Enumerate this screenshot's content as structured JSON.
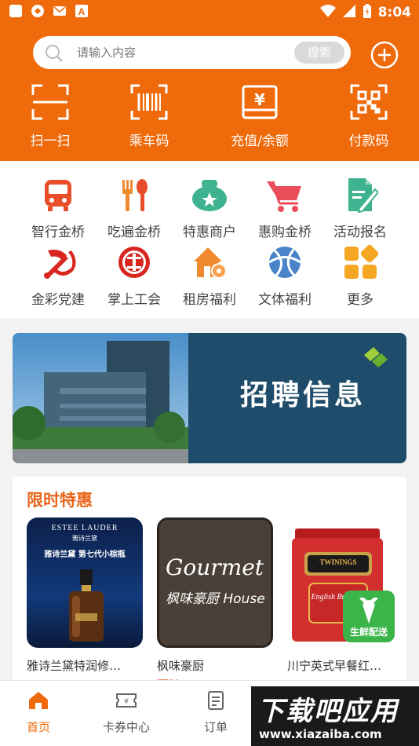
{
  "status_bar": {
    "time": "8:04"
  },
  "search": {
    "placeholder": "请输入内容",
    "button_label": "搜索"
  },
  "quick_actions": [
    {
      "label": "扫一扫",
      "icon": "scan-icon"
    },
    {
      "label": "乘车码",
      "icon": "barcode-icon"
    },
    {
      "label": "充值/余额",
      "icon": "yuan-wallet-icon"
    },
    {
      "label": "付款码",
      "icon": "qrcode-icon"
    }
  ],
  "services": [
    {
      "label": "智行金桥",
      "icon": "bus-icon"
    },
    {
      "label": "吃遍金桥",
      "icon": "fork-spoon-icon"
    },
    {
      "label": "特惠商户",
      "icon": "money-bag-icon"
    },
    {
      "label": "惠购金桥",
      "icon": "cart-icon"
    },
    {
      "label": "活动报名",
      "icon": "edit-form-icon"
    },
    {
      "label": "金彩党建",
      "icon": "party-emblem-icon"
    },
    {
      "label": "掌上工会",
      "icon": "union-emblem-icon"
    },
    {
      "label": "租房福利",
      "icon": "house-key-icon"
    },
    {
      "label": "文体福利",
      "icon": "ball-icon"
    },
    {
      "label": "更多",
      "icon": "more-grid-icon"
    }
  ],
  "banner": {
    "text": "招聘信息"
  },
  "flash_sale": {
    "title": "限时特惠",
    "products": [
      {
        "name": "雅诗兰黛特润修…",
        "image_brand": "ESTEE LAUDER",
        "image_cn": "雅诗兰黛",
        "image_headline": "雅诗兰黛 第七代小棕瓶"
      },
      {
        "name": "枫味豪厨",
        "image_text_1": "Gourmet",
        "image_text_2": "枫味豪厨 House"
      },
      {
        "name": "川宁英式早餐红…",
        "image_brand": "TWININGS",
        "image_sub": "English Breakfast"
      }
    ],
    "partial_price_text": "券后"
  },
  "fresh_badge": {
    "label": "生鲜配送"
  },
  "bottom_nav": [
    {
      "label": "首页",
      "icon": "home-icon",
      "active": true
    },
    {
      "label": "卡券中心",
      "icon": "coupon-icon",
      "active": false
    },
    {
      "label": "订单",
      "icon": "order-icon",
      "active": false
    }
  ],
  "watermark": {
    "title": "下载吧应用",
    "url": "www.xiazaiba.com"
  },
  "colors": {
    "primary": "#ef6a0b",
    "accent_red": "#e64a19",
    "fresh_green": "#3bb54a"
  }
}
